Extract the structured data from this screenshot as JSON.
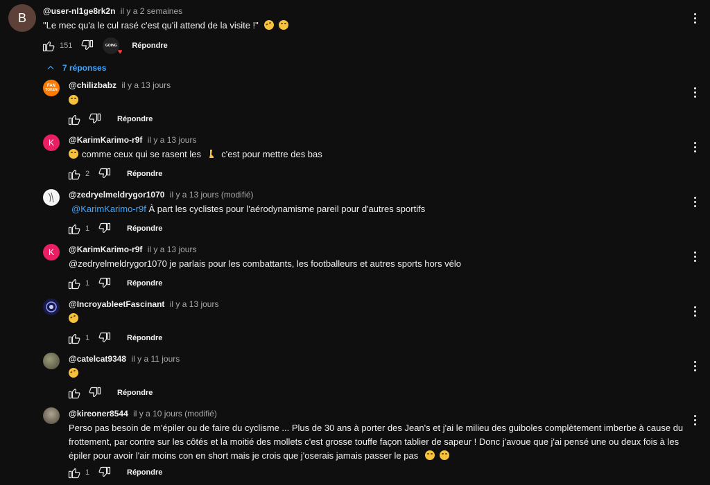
{
  "top_comment": {
    "avatar_letter": "B",
    "author": "@user-nl1ge8rk2n",
    "time": "il y a 2 semaines",
    "text": "\"Le mec qu'a le cul rasé c'est qu'il attend de la visite !\"",
    "likes": "151",
    "reply_label": "Répondre",
    "creator_badge_text": "GOING",
    "emojis": [
      "rolling-on-floor-laughing",
      "grinning-squinting"
    ]
  },
  "replies_toggle": {
    "label": "7 réponses"
  },
  "replies": [
    {
      "author": "@chilizbabz",
      "time": "il y a 13 jours",
      "text": "",
      "likes": "",
      "reply_label": "Répondre",
      "avatar": {
        "kind": "fan-token",
        "text": "FAN TOKEN",
        "color": "#ff7a00"
      },
      "emojis": [
        "grinning-sweat"
      ]
    },
    {
      "author": "@KarimKarimo-r9f",
      "time": "il y a 13 jours",
      "text_before": "comme ceux qui se rasent les",
      "text_after": "c'est pour mettre des bas",
      "likes": "2",
      "reply_label": "Répondre",
      "avatar": {
        "kind": "letter",
        "text": "K",
        "color": "#e91e63"
      },
      "emojis": [
        "grinning-squinting",
        "leg"
      ]
    },
    {
      "author": "@zedryelmeldrygor1070",
      "time": "il y a 13 jours (modifié)",
      "mention": "@KarimKarimo-r9f",
      "text": "À part les cyclistes pour l'aérodynamisme pareil pour d'autres sportifs",
      "likes": "1",
      "reply_label": "Répondre",
      "avatar": {
        "kind": "sketch",
        "color": "#f5f5f5"
      }
    },
    {
      "author": "@KarimKarimo-r9f",
      "time": "il y a 13 jours",
      "text": "@zedryelmeldrygor1070 je parlais pour les combattants, les footballeurs et autres sports hors vélo",
      "likes": "1",
      "reply_label": "Répondre",
      "avatar": {
        "kind": "letter",
        "text": "K",
        "color": "#e91e63"
      }
    },
    {
      "author": "@IncroyableetFascinant",
      "time": "il y a 13 jours",
      "text": "",
      "likes": "1",
      "reply_label": "Répondre",
      "avatar": {
        "kind": "eye",
        "color": "#1a1a4a"
      },
      "emojis": [
        "rolling-on-floor-laughing"
      ]
    },
    {
      "author": "@catelcat9348",
      "time": "il y a 11 jours",
      "text": "",
      "likes": "",
      "reply_label": "Répondre",
      "avatar": {
        "kind": "photo",
        "color": "#6b6b5a"
      },
      "emojis": [
        "rolling-on-floor-laughing"
      ]
    },
    {
      "author": "@kireoner8544",
      "time": "il y a 10 jours (modifié)",
      "text_line1": "Perso pas besoin de m'épiler ou de faire du cyclisme ... Plus de 30 ans à porter des Jean's et j'ai le milieu des guiboles complètement imberbe à cause du",
      "text_line2": "frottement, par contre sur les côtés et la moitié des mollets c'est grosse touffe façon tablier de sapeur ! Donc j'avoue que j'ai pensé une ou deux fois à les",
      "text_line3": "épiler pour avoir l'air moins con en short mais je crois que j'oserais jamais passer le pas",
      "likes": "1",
      "reply_label": "Répondre",
      "avatar": {
        "kind": "photo",
        "color": "#8a8070"
      },
      "emojis": [
        "grinning-sweat",
        "grinning-squinting"
      ]
    }
  ],
  "colors": {
    "background": "#0f0f0f",
    "text": "#f1f1f1",
    "secondary": "#aaaaaa",
    "link": "#3ea6ff"
  },
  "icons": {
    "like": "thumb-up-icon",
    "dislike": "thumb-down-icon",
    "menu": "more-vert-icon",
    "collapse": "chevron-up-icon"
  }
}
